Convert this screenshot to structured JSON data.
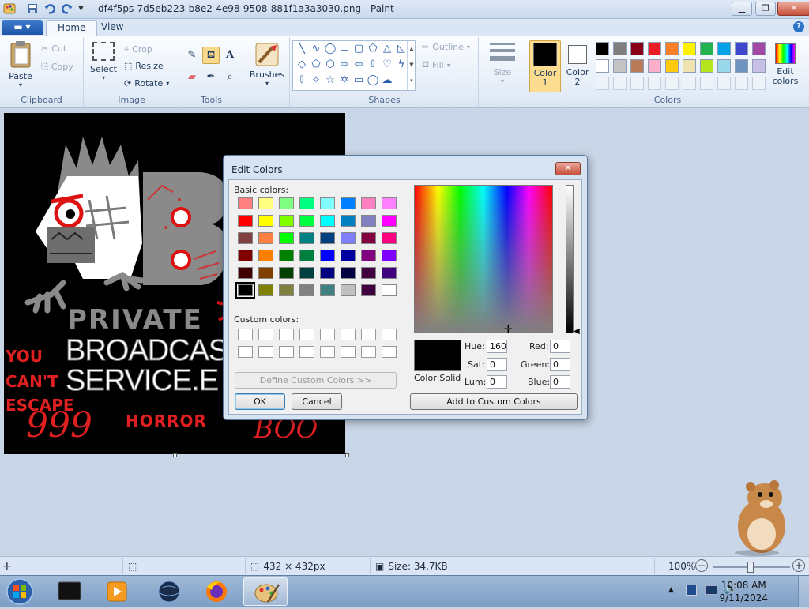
{
  "window": {
    "title": "df4f5ps-7d5eb223-b8e2-4e98-9508-881f1a3a3030.png - Paint",
    "min_label": "▁",
    "max_label": "❐",
    "close_label": "✕"
  },
  "tabs": [
    {
      "label": "Home",
      "active": true
    },
    {
      "label": "View",
      "active": false
    }
  ],
  "help_label": "?",
  "ribbon": {
    "clipboard": {
      "label": "Clipboard",
      "paste": "Paste",
      "cut": "Cut",
      "copy": "Copy"
    },
    "image": {
      "label": "Image",
      "select": "Select",
      "crop": "Crop",
      "resize": "Resize",
      "rotate": "Rotate"
    },
    "tools": {
      "label": "Tools"
    },
    "brushes": {
      "label": "Brushes"
    },
    "shapes": {
      "label": "Shapes",
      "outline": "Outline",
      "fill": "Fill"
    },
    "size": {
      "label": "Size"
    },
    "colors": {
      "label": "Colors",
      "color1": "Color\n1",
      "color2": "Color\n2",
      "edit_colors": "Edit\ncolors",
      "palette": [
        "#000000",
        "#7f7f7f",
        "#880015",
        "#ed1c24",
        "#ff7f27",
        "#fff200",
        "#22b14c",
        "#00a2e8",
        "#3f48cc",
        "#a349a4",
        "#ffffff",
        "#c3c3c3",
        "#b97a57",
        "#ffaec9",
        "#ffc90e",
        "#efe4b0",
        "#b5e61d",
        "#99d9ea",
        "#7092be",
        "#c8bfe7"
      ]
    }
  },
  "canvas": {
    "text_private": "PRIVATE",
    "text_broadcast": "BROADCAS",
    "text_service": "SERVICE.E",
    "text_you": "YOU",
    "text_cant": "CAN'T",
    "text_escape": "ESCAPE",
    "text_999": "999",
    "text_horror": "HORROR",
    "text_boo": "BOO",
    "text_big_b": "B"
  },
  "dialog": {
    "title": "Edit Colors",
    "close_label": "✕",
    "basic_colors_label": "Basic colors:",
    "custom_colors_label": "Custom colors:",
    "define_custom": "Define Custom Colors >>",
    "ok": "OK",
    "cancel": "Cancel",
    "add_to_custom": "Add to Custom Colors",
    "color_solid": "Color|Solid",
    "hue_label": "Hue:",
    "hue": "160",
    "sat_label": "Sat:",
    "sat": "0",
    "lum_label": "Lum:",
    "lum": "0",
    "red_label": "Red:",
    "red": "0",
    "green_label": "Green:",
    "green": "0",
    "blue_label": "Blue:",
    "blue": "0",
    "basic_colors": [
      "#ff8080",
      "#ffff80",
      "#80ff80",
      "#00ff80",
      "#80ffff",
      "#0080ff",
      "#ff80c0",
      "#ff80ff",
      "#ff0000",
      "#ffff00",
      "#80ff00",
      "#00ff40",
      "#00ffff",
      "#0080c0",
      "#8080c0",
      "#ff00ff",
      "#804040",
      "#ff8040",
      "#00ff00",
      "#008080",
      "#004080",
      "#8080ff",
      "#800040",
      "#ff0080",
      "#800000",
      "#ff8000",
      "#008000",
      "#008040",
      "#0000ff",
      "#0000a0",
      "#800080",
      "#8000ff",
      "#400000",
      "#804000",
      "#004000",
      "#004040",
      "#000080",
      "#000040",
      "#400040",
      "#400080",
      "#000000",
      "#808000",
      "#808040",
      "#808080",
      "#408080",
      "#c0c0c0",
      "#400040",
      "#ffffff"
    ]
  },
  "status": {
    "dimensions": "432 × 432px",
    "size": "Size: 34.7KB",
    "zoom": "100%"
  },
  "taskbar": {
    "time": "10:08 AM",
    "date": "9/11/2024"
  }
}
